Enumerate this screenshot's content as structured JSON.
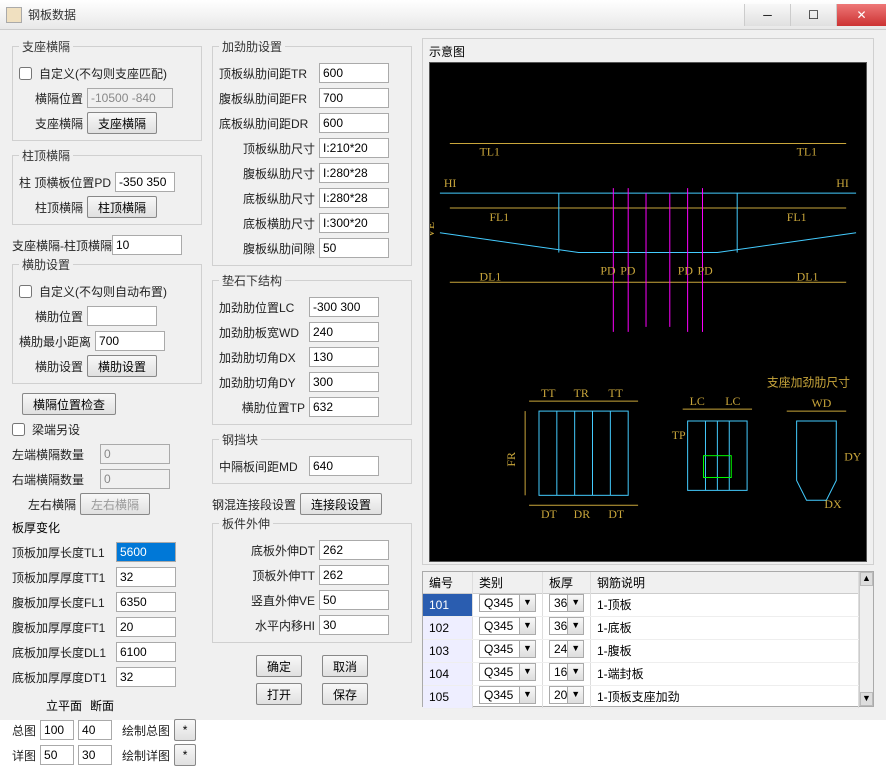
{
  "window": {
    "title": "钢板数据"
  },
  "zhizuo": {
    "legend": "支座横隔",
    "chk": "自定义(不勾则支座匹配)",
    "pos_lbl": "横隔位置",
    "pos": "-10500 -840",
    "btn_lbl": "支座横隔",
    "btn": "支座横隔"
  },
  "zhuding": {
    "legend": "柱顶横隔",
    "pd_lbl": "柱 顶横板位置PD",
    "pd": "-350 350",
    "btn_lbl": "柱顶横隔",
    "btn": "柱顶横隔"
  },
  "hebing": {
    "lbl": "支座横隔-柱顶横隔合并距离",
    "val": "10"
  },
  "henglei": {
    "legend": "横肋设置",
    "chk": "自定义(不勾则自动布置)",
    "pos_lbl": "横肋位置",
    "pos": "",
    "min_lbl": "横肋最小距离",
    "min": "700",
    "btn_lbl": "横肋设置",
    "btn": "横肋设置"
  },
  "hg_check": "横隔位置检查",
  "liangduan": {
    "chk": "梁端另设",
    "left_lbl": "左端横隔数量",
    "left": "0",
    "right_lbl": "右端横隔数量",
    "right": "0",
    "lr_lbl": "左右横隔",
    "lr_btn": "左右横隔"
  },
  "banhou": {
    "legend": "板厚变化",
    "tl1_lbl": "顶板加厚长度TL1",
    "tl1": "5600",
    "tt1_lbl": "顶板加厚厚度TT1",
    "tt1": "32",
    "fl1_lbl": "腹板加厚长度FL1",
    "fl1": "6350",
    "ft1_lbl": "腹板加厚厚度FT1",
    "ft1": "20",
    "dl1_lbl": "底板加厚长度DL1",
    "dl1": "6100",
    "dt1_lbl": "底板加厚厚度DT1",
    "dt1": "32"
  },
  "lp": {
    "h1": "立平面",
    "h2": "断面",
    "zt_lbl": "总图",
    "zt1": "100",
    "zt2": "40",
    "zt_btn": "绘制总图",
    "xt_lbl": "详图",
    "xt1": "50",
    "xt2": "30",
    "xt_btn": "绘制详图",
    "star": "*"
  },
  "jiajin": {
    "legend": "加劲肋设置",
    "tr_lbl": "顶板纵肋间距TR",
    "tr": "600",
    "fr_lbl": "腹板纵肋间距FR",
    "fr": "700",
    "dr_lbl": "底板纵肋间距DR",
    "dr": "600",
    "tsize_lbl": "顶板纵肋尺寸",
    "tsize": "I:210*20",
    "fsize_lbl": "腹板纵肋尺寸",
    "I:280*28": "I:280*28",
    "fsize": "I:280*28",
    "dsize_lbl": "底板纵肋尺寸",
    "dsize": "I:280*28",
    "dheng_lbl": "底板横肋尺寸",
    "dheng": "I:300*20",
    "fgap_lbl": "腹板纵肋间隙",
    "fgap": "50"
  },
  "dianshi": {
    "legend": "垫石下结构",
    "lc_lbl": "加劲肋位置LC",
    "lc": "-300 300",
    "wd_lbl": "加劲肋板宽WD",
    "wd": "240",
    "dx_lbl": "加劲肋切角DX",
    "dx": "130",
    "dy_lbl": "加劲肋切角DY",
    "dy": "300",
    "tp_lbl": "横肋位置TP",
    "tp": "632"
  },
  "gangdang": {
    "legend": "钢挡块",
    "md_lbl": "中隔板间距MD",
    "md": "640"
  },
  "ghlj": {
    "lbl": "钢混连接段设置",
    "btn": "连接段设置"
  },
  "banjian": {
    "legend": "板件外伸",
    "dt_lbl": "底板外伸DT",
    "dt": "262",
    "tt_lbl": "顶板外伸TT",
    "tt": "262",
    "ve_lbl": "竖直外伸VE",
    "ve": "50",
    "hi_lbl": "水平内移HI",
    "hi": "30"
  },
  "actions": {
    "ok": "确定",
    "cancel": "取消",
    "open": "打开",
    "save": "保存"
  },
  "diagram": {
    "title": "示意图",
    "labels": {
      "tl1l": "TL1",
      "tl1r": "TL1",
      "fl1l": "FL1",
      "fl1r": "FL1",
      "dl1l": "DL1",
      "dl1r": "DL1",
      "hil": "HI",
      "hir": "HI",
      "ve": "VE",
      "pd1": "PD",
      "pd2": "PD",
      "pd3": "PD",
      "pd4": "PD",
      "tt": "TT",
      "tr": "TR",
      "tt2": "TT",
      "dt": "DT",
      "dr": "DR",
      "dt2": "DT",
      "fr": "FR",
      "lc": "LC",
      "lc2": "LC",
      "tp": "TP",
      "wd": "WD",
      "dy": "DY",
      "dx": "DX",
      "zj": "支座加劲肋尺寸"
    }
  },
  "table": {
    "headers": {
      "c0": "编号",
      "c1": "类别",
      "c2": "板厚",
      "c3": "钢筋说明"
    },
    "rows": [
      {
        "id": "101",
        "type": "Q345",
        "thk": "36",
        "desc": "1-顶板"
      },
      {
        "id": "102",
        "type": "Q345",
        "thk": "36",
        "desc": "1-底板"
      },
      {
        "id": "103",
        "type": "Q345",
        "thk": "24",
        "desc": "1-腹板"
      },
      {
        "id": "104",
        "type": "Q345",
        "thk": "16",
        "desc": "1-端封板"
      },
      {
        "id": "105",
        "type": "Q345",
        "thk": "20",
        "desc": "1-顶板支座加劲"
      }
    ]
  }
}
